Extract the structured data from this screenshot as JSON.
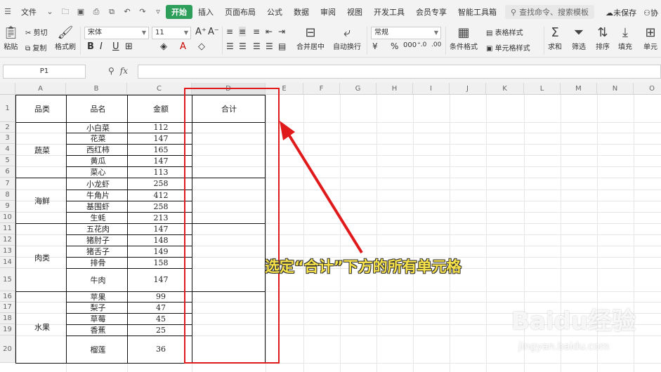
{
  "menubar": {
    "file_label": "文件",
    "start_tab": "开始",
    "tabs": [
      "插入",
      "页面布局",
      "公式",
      "数据",
      "审阅",
      "视图",
      "开发工具",
      "会员专享",
      "智能工具箱"
    ],
    "search_placeholder": "查找命令、搜索模板",
    "right_save": "未保存",
    "right_collab": "协"
  },
  "ribbon": {
    "paste": "粘贴",
    "cut": "剪切",
    "copy": "复制",
    "format_painter": "格式刷",
    "font_name": "宋体",
    "font_size": "11",
    "merge_center": "合并居中",
    "wrap_text": "自动换行",
    "number_format": "常规",
    "conditional_format": "条件格式",
    "table_style": "表格样式",
    "cell_style": "单元格样式",
    "sum": "求和",
    "filter": "筛选",
    "sort": "排序",
    "fill": "填充",
    "cell": "单元"
  },
  "formula_bar": {
    "cell_ref": "P1",
    "fx_label": "fx"
  },
  "columns": [
    "A",
    "B",
    "C",
    "D",
    "E",
    "F",
    "G",
    "H",
    "I",
    "J",
    "K",
    "L",
    "M",
    "N",
    "O"
  ],
  "rows": [
    "1",
    "2",
    "3",
    "4",
    "5",
    "6",
    "7",
    "8",
    "9",
    "10",
    "11",
    "12",
    "13",
    "14",
    "15",
    "16",
    "17",
    "18",
    "19",
    "20"
  ],
  "table": {
    "headers": [
      "品类",
      "品名",
      "金额",
      "合计"
    ],
    "categories": [
      "蔬菜",
      "海鲜",
      "肉类",
      "水果"
    ],
    "items": [
      {
        "name": "小白菜",
        "amount": "112"
      },
      {
        "name": "花菜",
        "amount": "147"
      },
      {
        "name": "西红柿",
        "amount": "165"
      },
      {
        "name": "黄瓜",
        "amount": "147"
      },
      {
        "name": "菜心",
        "amount": "113"
      },
      {
        "name": "小龙虾",
        "amount": "258"
      },
      {
        "name": "牛角片",
        "amount": "412"
      },
      {
        "name": "基围虾",
        "amount": "258"
      },
      {
        "name": "生蚝",
        "amount": "213"
      },
      {
        "name": "五花肉",
        "amount": "147"
      },
      {
        "name": "猪肘子",
        "amount": "148"
      },
      {
        "name": "猪舌子",
        "amount": "149"
      },
      {
        "name": "排骨",
        "amount": "158"
      },
      {
        "name": "牛肉",
        "amount": "147"
      },
      {
        "name": "苹果",
        "amount": "99"
      },
      {
        "name": "梨子",
        "amount": "47"
      },
      {
        "name": "草莓",
        "amount": "45"
      },
      {
        "name": "香蕉",
        "amount": "25"
      },
      {
        "name": "榴莲",
        "amount": "36"
      }
    ]
  },
  "annotation": {
    "text": "选定“合计”下方的所有单元格",
    "color": "#f7e24a",
    "box_color": "#e0191b"
  },
  "watermark": {
    "brand": "Baidu经验",
    "url": "jingyan.baidu.com"
  },
  "colors": {
    "accent": "#2e9e5b"
  }
}
